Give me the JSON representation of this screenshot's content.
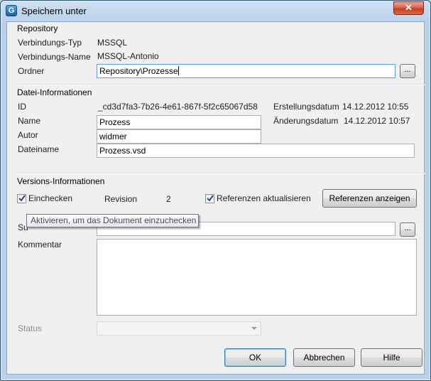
{
  "window": {
    "title": "Speichern unter",
    "app_icon": "G",
    "close_glyph": "✕"
  },
  "repository": {
    "group_title": "Repository",
    "connection_type_label": "Verbindungs-Typ",
    "connection_type_value": "MSSQL",
    "connection_name_label": "Verbindungs-Name",
    "connection_name_value": "MSSQL-Antonio",
    "folder_label": "Ordner",
    "folder_value": "Repository\\Prozesse",
    "browse_label": "..."
  },
  "file_info": {
    "group_title": "Datei-Informationen",
    "id_label": "ID",
    "id_value": "_cd3d7fa3-7b26-4e61-867f-5f2c65067d58",
    "created_label": "Erstellungsdatum",
    "created_value": "14.12.2012 10:55",
    "modified_label": "Änderungsdatum",
    "modified_value": "14.12.2012 10:57",
    "name_label": "Name",
    "name_value": "Prozess",
    "author_label": "Autor",
    "author_value": "widmer",
    "filename_label": "Dateiname",
    "filename_value": "Prozess.vsd"
  },
  "version_info": {
    "group_title": "Versions-Informationen",
    "checkin_label": "Einchecken",
    "checkin_checked": true,
    "revision_label": "Revision",
    "revision_value": "2",
    "update_refs_label": "Referenzen aktualisieren",
    "update_refs_checked": true,
    "show_refs_button": "Referenzen anzeigen",
    "keywords_label_partial": "Su",
    "keywords_value": "",
    "keywords_browse_label": "...",
    "comment_label": "Kommentar",
    "comment_value": "",
    "status_label": "Status",
    "status_value": ""
  },
  "tooltip": {
    "text": "Aktivieren, um das Dokument einzuchecken"
  },
  "buttons": {
    "ok": "OK",
    "cancel": "Abbrechen",
    "help": "Hilfe"
  },
  "colors": {
    "accent": "#3c7fb1",
    "title_bar": "#b9d1ea",
    "close": "#c23c22"
  }
}
